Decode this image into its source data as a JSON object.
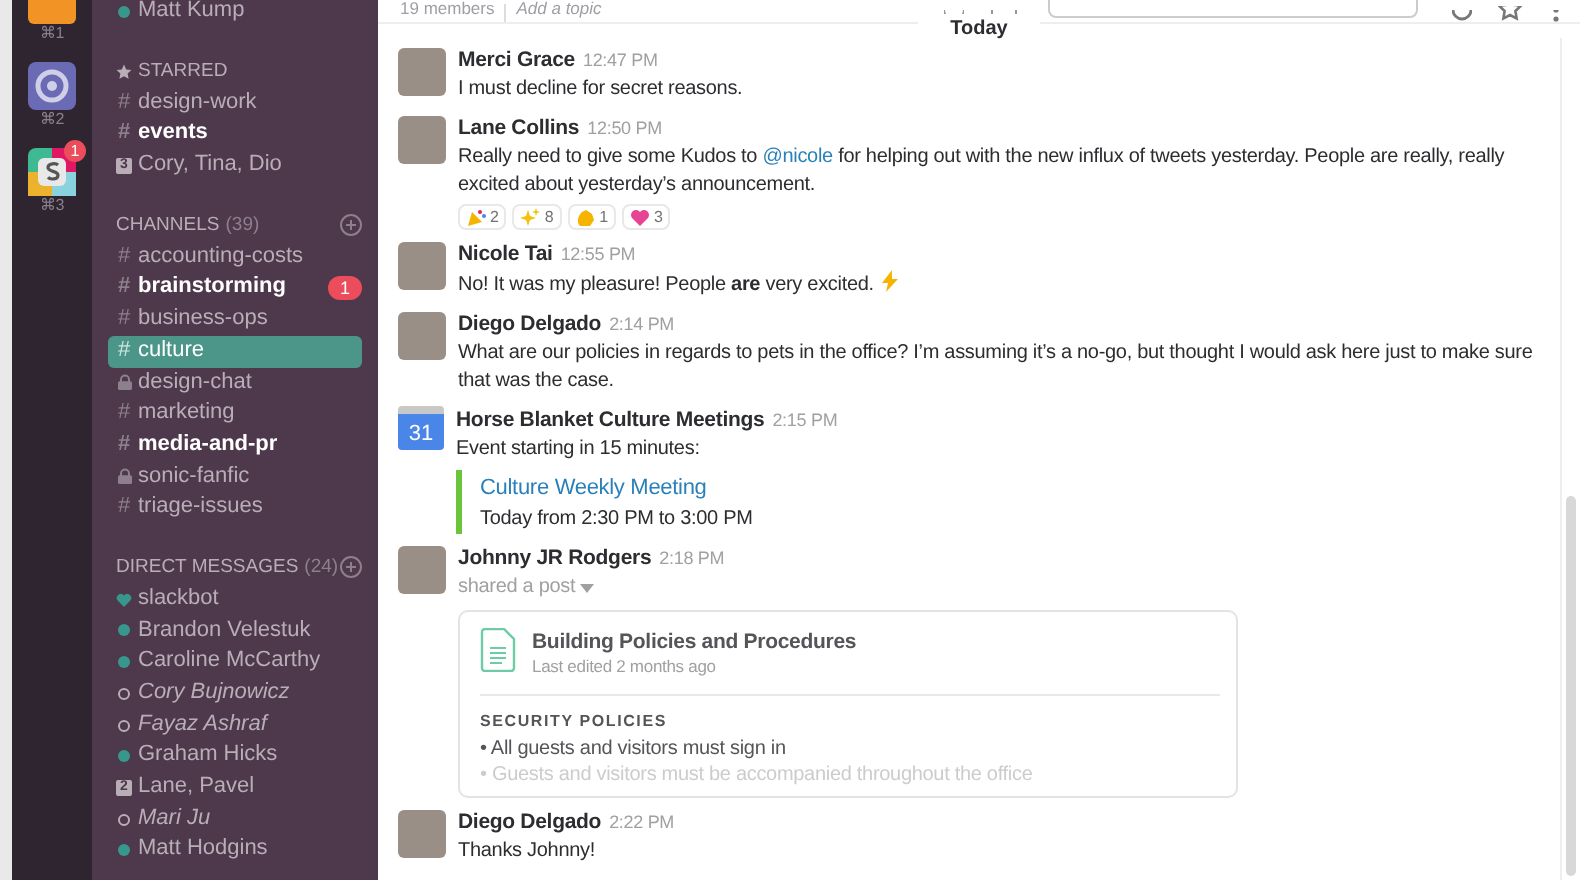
{
  "teams": [
    {
      "kind": "tile",
      "shortcut": "⌘1"
    },
    {
      "kind": "ring",
      "shortcut": "⌘2"
    },
    {
      "kind": "slack",
      "shortcut": "⌘3",
      "badge": "1"
    }
  ],
  "sidebar": {
    "user": {
      "name": "Matt Kump",
      "online": true
    },
    "starred": {
      "title": "STARRED",
      "items": [
        {
          "kind": "channel",
          "prefix": "#",
          "name": "design-work",
          "unread": false,
          "selected": false
        },
        {
          "kind": "channel",
          "prefix": "#",
          "name": "events",
          "unread": true,
          "selected": false
        },
        {
          "kind": "group",
          "count": "3",
          "name": "Cory, Tina, Dio",
          "unread": false,
          "selected": false
        }
      ]
    },
    "channels": {
      "title": "CHANNELS",
      "count": "(39)",
      "items": [
        {
          "kind": "channel",
          "prefix": "#",
          "name": "accounting-costs",
          "unread": false,
          "selected": false
        },
        {
          "kind": "channel",
          "prefix": "#",
          "name": "brainstorming",
          "unread": true,
          "selected": false,
          "badge": "1"
        },
        {
          "kind": "channel",
          "prefix": "#",
          "name": "business-ops",
          "unread": false,
          "selected": false
        },
        {
          "kind": "channel",
          "prefix": "#",
          "name": "culture",
          "unread": false,
          "selected": true
        },
        {
          "kind": "private",
          "name": "design-chat",
          "unread": false,
          "selected": false
        },
        {
          "kind": "channel",
          "prefix": "#",
          "name": "marketing",
          "unread": false,
          "selected": false
        },
        {
          "kind": "channel",
          "prefix": "#",
          "name": "media-and-pr",
          "unread": true,
          "selected": false
        },
        {
          "kind": "private",
          "name": "sonic-fanfic",
          "unread": false,
          "selected": false
        },
        {
          "kind": "channel",
          "prefix": "#",
          "name": "triage-issues",
          "unread": false,
          "selected": false
        }
      ]
    },
    "direct_messages": {
      "title": "DIRECT MESSAGES",
      "count": "(24)",
      "items": [
        {
          "kind": "bot",
          "name": "slackbot"
        },
        {
          "kind": "person",
          "name": "Brandon Velestuk",
          "online": true
        },
        {
          "kind": "person",
          "name": "Caroline McCarthy",
          "online": true
        },
        {
          "kind": "person",
          "name": "Cory Bujnowicz",
          "online": false
        },
        {
          "kind": "person",
          "name": "Fayaz Ashraf",
          "online": false
        },
        {
          "kind": "person",
          "name": "Graham Hicks",
          "online": true
        },
        {
          "kind": "group",
          "count": "2",
          "name": "Lane, Pavel"
        },
        {
          "kind": "person",
          "name": "Mari Ju",
          "online": false
        },
        {
          "kind": "person",
          "name": "Matt Hodgins",
          "online": true
        }
      ]
    }
  },
  "header": {
    "members": "19 members",
    "topic": "Add a topic"
  },
  "day_divider": "Today",
  "messages": [
    {
      "kind": "text",
      "author": "Merci Grace",
      "time": "12:47 PM",
      "parts": [
        {
          "kind": "text",
          "text": "I must decline for secret reasons."
        }
      ]
    },
    {
      "kind": "text",
      "author": "Lane Collins",
      "time": "12:50 PM",
      "parts": [
        {
          "kind": "text",
          "text": "Really need to give some Kudos to "
        },
        {
          "kind": "mention",
          "text": "@nicole"
        },
        {
          "kind": "text",
          "text": " for helping out with the new influx of tweets yesterday. People are really, really excited about yesterday’s announcement."
        }
      ],
      "reactions": [
        {
          "kind": "party",
          "count": "2"
        },
        {
          "kind": "sparkles",
          "count": "8"
        },
        {
          "kind": "clap",
          "count": "1"
        },
        {
          "kind": "heart",
          "count": "3"
        }
      ]
    },
    {
      "kind": "text",
      "author": "Nicole Tai",
      "time": "12:55 PM",
      "parts": [
        {
          "kind": "text",
          "text": "No! It was my pleasure! People **are** very excited."
        },
        {
          "kind": "bolt"
        }
      ]
    },
    {
      "kind": "text",
      "author": "Diego Delgado",
      "time": "2:14 PM",
      "parts": [
        {
          "kind": "text",
          "text": "What are our policies in regards to pets in the office? I’m assuming it’s a no-go, but thought I would ask here just to make sure that was the case."
        }
      ]
    },
    {
      "kind": "event",
      "author": "Horse Blanket Culture Meetings",
      "time": "2:15 PM",
      "calendar_day": "31",
      "intro": "Event starting in 15 minutes:",
      "event_title": "Culture Weekly Meeting",
      "event_when": "Today from 2:30 PM to 3:00 PM"
    },
    {
      "kind": "post",
      "author": "Johnny JR Rodgers",
      "time": "2:18 PM",
      "shared": "shared a post",
      "post": {
        "title": "Building Policies and Procedures",
        "meta": "Last edited 2 months ago",
        "section": "SECURITY POLICIES",
        "bullets": [
          {
            "marker": "•",
            "text": "All guests and visitors must sign in",
            "faded": false
          },
          {
            "marker": "•",
            "text": "Guests and visitors must be accompanied throughout the office",
            "faded": true
          }
        ]
      }
    },
    {
      "kind": "text",
      "author": "Diego Delgado",
      "time": "2:22 PM",
      "parts": [
        {
          "kind": "text",
          "text": "Thanks Johnny!"
        }
      ]
    }
  ]
}
